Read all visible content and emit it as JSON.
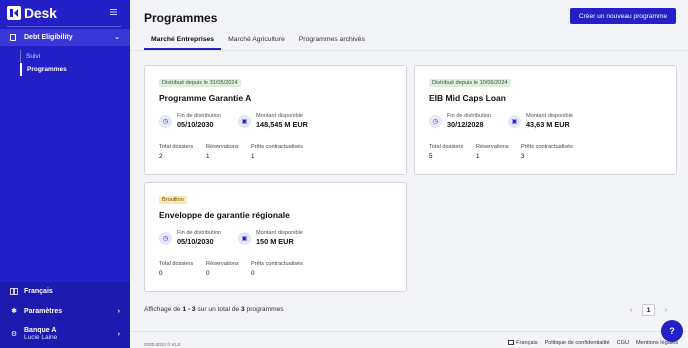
{
  "app": {
    "name": "Desk"
  },
  "sidebar": {
    "nav": {
      "label": "Debt Eligibility"
    },
    "sub_items": [
      "Suivi",
      "Programmes"
    ],
    "language": "Français",
    "settings": "Paramètres",
    "account": {
      "bank": "Banque A",
      "user": "Lucie Laine"
    }
  },
  "header": {
    "title": "Programmes",
    "create_button": "Créer un nouveau programme"
  },
  "tabs": [
    "Marché Entreprises",
    "Marché Agriculture",
    "Programmes archivés"
  ],
  "labels": {
    "end_distribution": "Fin de distribution",
    "amount_available": "Montant disponible",
    "total_files": "Total dossiers",
    "reservations": "Réservations",
    "contracted_loans": "Prêts contractualisés"
  },
  "cards": [
    {
      "badge": "Distribué depuis le 31/05/2024",
      "badge_color": "#ddeedd",
      "title": "Programme Garantie A",
      "end_date": "05/10/2030",
      "amount": "148,545 M EUR",
      "total": "2",
      "reservations": "1",
      "contracted": "1"
    },
    {
      "badge": "Distribué depuis le 10/06/2024",
      "badge_color": "#ddeedd",
      "title": "EIB Mid Caps Loan",
      "end_date": "30/12/2028",
      "amount": "43,63 M EUR",
      "total": "5",
      "reservations": "1",
      "contracted": "3"
    },
    {
      "badge": "Brouillon",
      "badge_color": "#fbe8b5",
      "title": "Enveloppe de garantie régionale",
      "end_date": "05/10/2030",
      "amount": "150 M EUR",
      "total": "0",
      "reservations": "0",
      "contracted": "0"
    }
  ],
  "pagination": {
    "prefix": "Affichage de ",
    "range": "1 - 3",
    "middle": " sur un total de ",
    "total": "3",
    "suffix": " programmes",
    "current_page": "1"
  },
  "footer": {
    "copyright": "2020-2024 © KLS",
    "language": "Français",
    "privacy": "Politique de confidentialité",
    "terms": "CGU",
    "legal": "Mentions légales"
  },
  "help": "?",
  "colors": {
    "primary": "#2420c8",
    "sidebar_bottom": "#1e1ab0"
  },
  "icons": [
    "menu-icon",
    "document-icon",
    "chevron-down-icon",
    "globe-icon",
    "gear-icon",
    "chevron-right-icon",
    "clock-icon",
    "wallet-icon",
    "chevron-left-icon",
    "flag-icon",
    "question-icon"
  ]
}
